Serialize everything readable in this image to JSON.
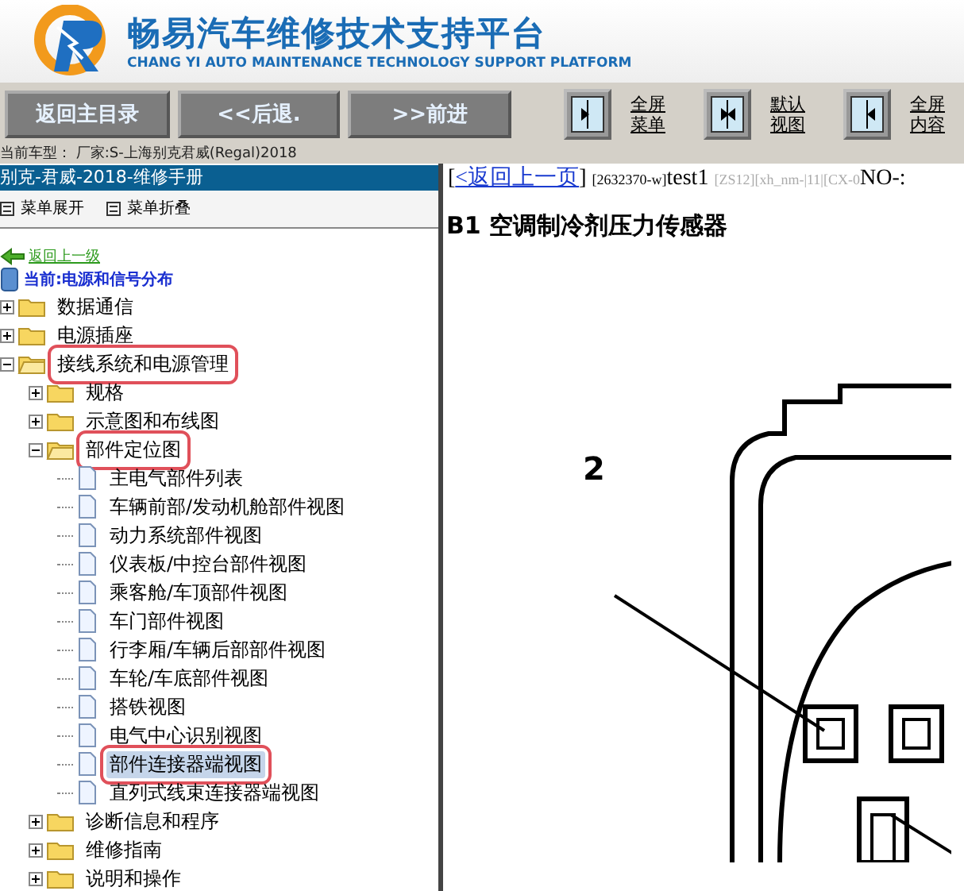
{
  "header": {
    "title": "畅易汽车维修技术支持平台",
    "subtitle": "CHANG YI AUTO MAINTENANCE TECHNOLOGY SUPPORT PLATFORM"
  },
  "nav_buttons": [
    "返回主目录",
    "<<后退.",
    ">>前进"
  ],
  "view_buttons": [
    {
      "kind": "menu",
      "label": "全屏菜单"
    },
    {
      "kind": "default",
      "label": "默认视图"
    },
    {
      "kind": "content",
      "label": "全屏内容"
    }
  ],
  "vehicle_line": "当前车型：  厂家:S-上海别克君威(Regal)2018",
  "sidebar": {
    "title": "别克-君威-2018-维修手册",
    "expand_all": "菜单展开",
    "collapse_all": "菜单折叠",
    "back_link": "返回上一级",
    "current": "当前:电源和信号分布",
    "tree": [
      {
        "label": "数据通信",
        "kind": "folder",
        "expanded": false,
        "annotated": false,
        "selected": false
      },
      {
        "label": "电源插座",
        "kind": "folder",
        "expanded": false,
        "annotated": false,
        "selected": false
      },
      {
        "label": "接线系统和电源管理",
        "kind": "folder",
        "expanded": true,
        "annotated": true,
        "selected": false,
        "children": [
          {
            "label": "规格",
            "kind": "folder",
            "expanded": false,
            "annotated": false,
            "selected": false
          },
          {
            "label": "示意图和布线图",
            "kind": "folder",
            "expanded": false,
            "annotated": false,
            "selected": false
          },
          {
            "label": "部件定位图",
            "kind": "folder",
            "expanded": true,
            "annotated": true,
            "selected": false,
            "children": [
              {
                "label": "主电气部件列表",
                "kind": "page",
                "annotated": false,
                "selected": false
              },
              {
                "label": "车辆前部/发动机舱部件视图",
                "kind": "page",
                "annotated": false,
                "selected": false
              },
              {
                "label": "动力系统部件视图",
                "kind": "page",
                "annotated": false,
                "selected": false
              },
              {
                "label": "仪表板/中控台部件视图",
                "kind": "page",
                "annotated": false,
                "selected": false
              },
              {
                "label": "乘客舱/车顶部件视图",
                "kind": "page",
                "annotated": false,
                "selected": false
              },
              {
                "label": "车门部件视图",
                "kind": "page",
                "annotated": false,
                "selected": false
              },
              {
                "label": "行李厢/车辆后部部件视图",
                "kind": "page",
                "annotated": false,
                "selected": false
              },
              {
                "label": "车轮/车底部件视图",
                "kind": "page",
                "annotated": false,
                "selected": false
              },
              {
                "label": "搭铁视图",
                "kind": "page",
                "annotated": false,
                "selected": false
              },
              {
                "label": "电气中心识别视图",
                "kind": "page",
                "annotated": false,
                "selected": false
              },
              {
                "label": "部件连接器端视图",
                "kind": "page",
                "annotated": true,
                "selected": true
              },
              {
                "label": "直列式线束连接器端视图",
                "kind": "page",
                "annotated": false,
                "selected": false
              }
            ]
          },
          {
            "label": "诊断信息和程序",
            "kind": "folder",
            "expanded": false,
            "annotated": false,
            "selected": false
          },
          {
            "label": "维修指南",
            "kind": "folder",
            "expanded": false,
            "annotated": false,
            "selected": false
          },
          {
            "label": "说明和操作",
            "kind": "folder",
            "expanded": false,
            "annotated": false,
            "selected": false
          }
        ]
      }
    ]
  },
  "content": {
    "bracket_open": "[",
    "back_link": "<返回上一页",
    "bracket_close": "]",
    "id": "[2632370-w]",
    "test": "test1",
    "codes": "[ZS12][xh_nm-|11|[CX-0",
    "number": "NO-:",
    "heading": "B1 空调制冷剂压力传感器",
    "callout": "2"
  }
}
